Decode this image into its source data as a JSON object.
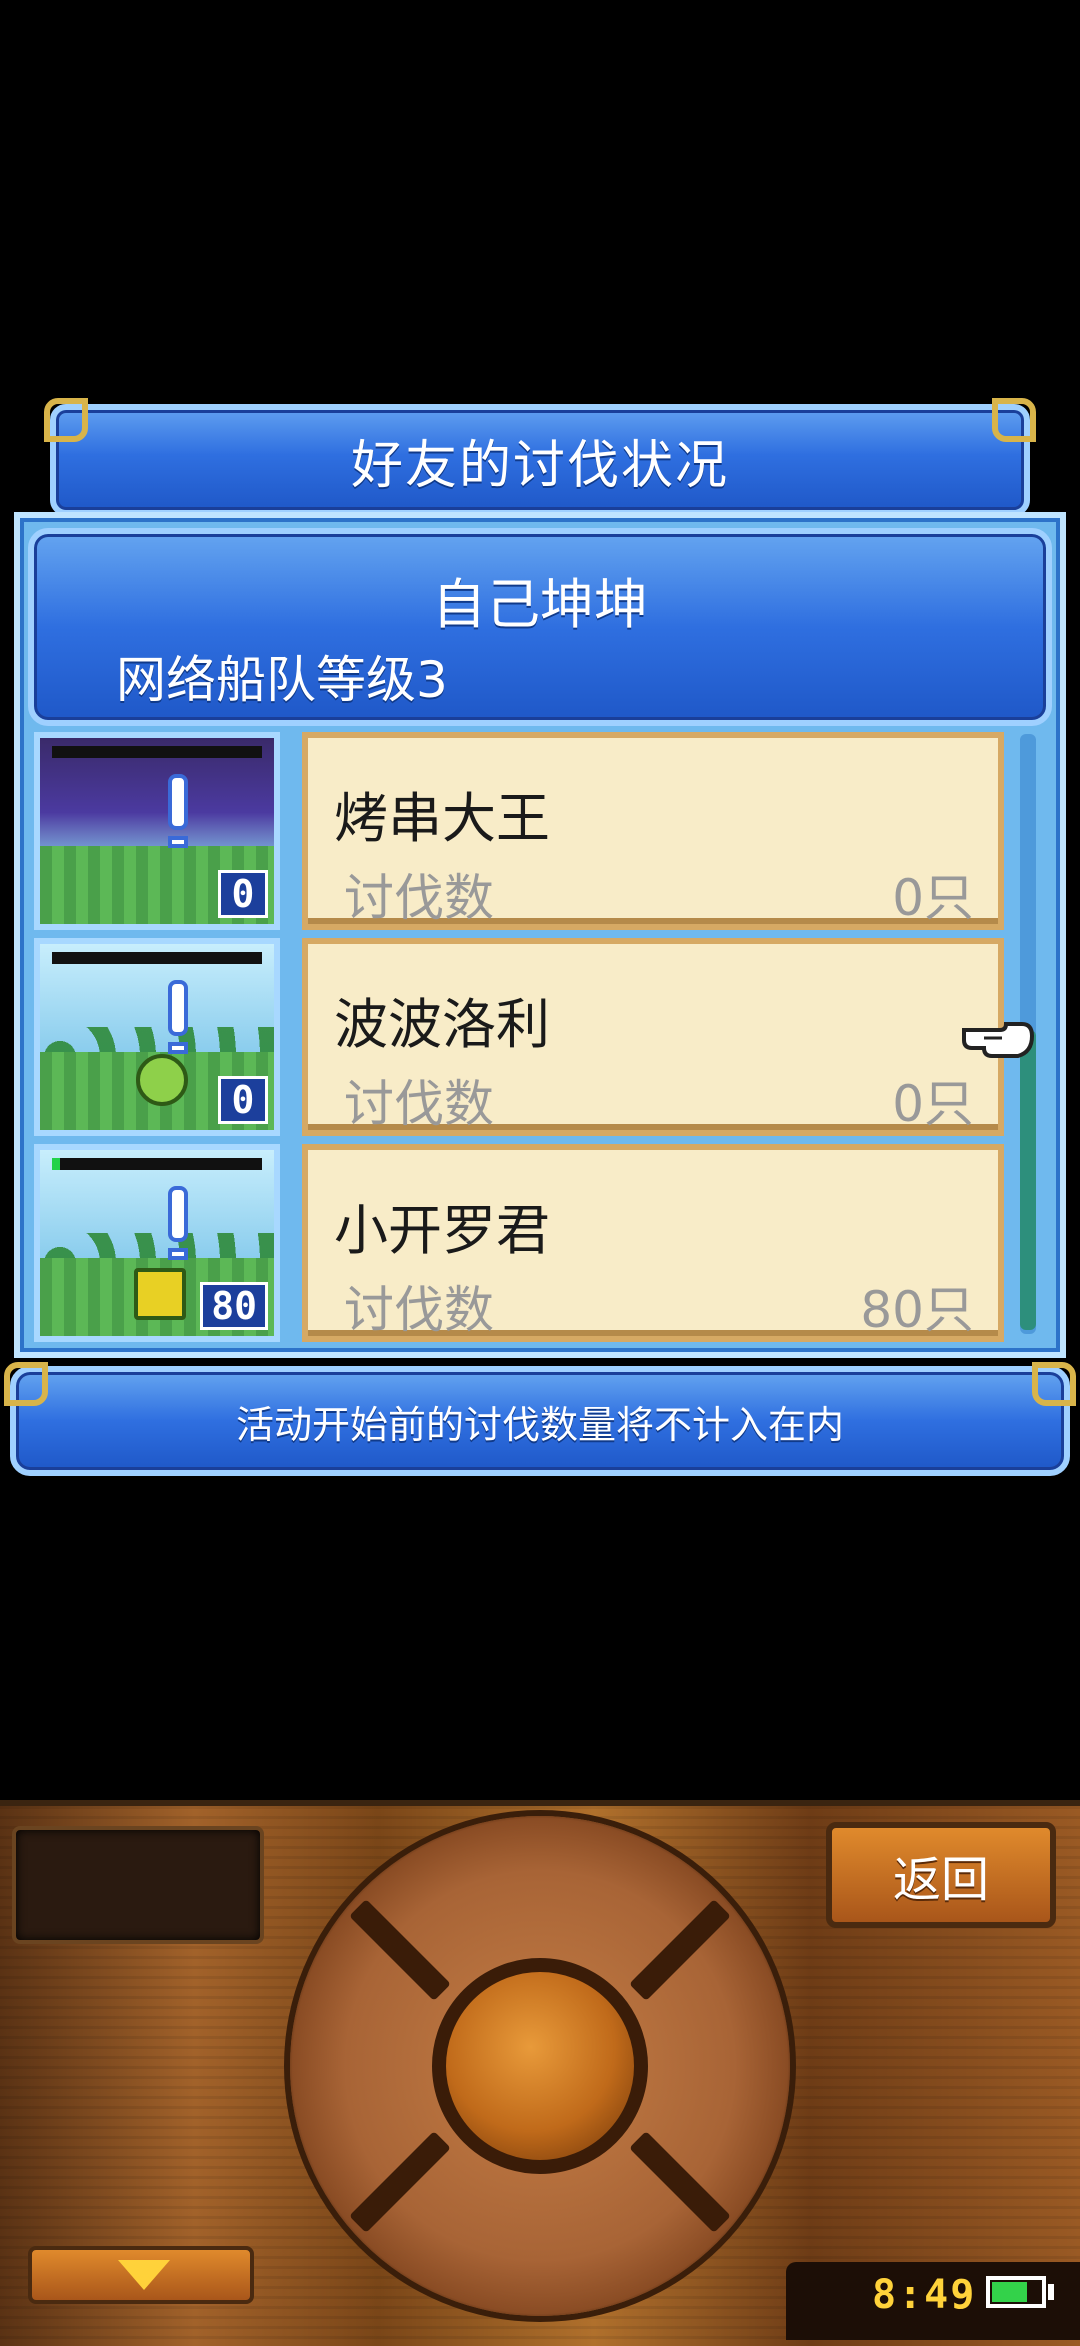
{
  "header": {
    "title": "好友的讨伐状况"
  },
  "profile": {
    "name": "自己坤坤",
    "level": "网络船队等级3"
  },
  "list": {
    "items": [
      {
        "name": "烤串大王",
        "label": "讨伐数",
        "value": "0只",
        "badge": "0",
        "hp_fraction": 0
      },
      {
        "name": "波波洛利",
        "label": "讨伐数",
        "value": "0只",
        "badge": "0",
        "hp_fraction": 0
      },
      {
        "name": "小开罗君",
        "label": "讨伐数",
        "value": "80只",
        "badge": "80",
        "hp_fraction": 0.04
      }
    ]
  },
  "notice": {
    "text": "活动开始前的讨伐数量将不计入在内"
  },
  "controls": {
    "back_label": "返回"
  },
  "status": {
    "time": "8:49",
    "battery_fraction": 0.75
  },
  "colors": {
    "panel_blue": "#2f6fe0",
    "card_cream": "#f8ecc8",
    "wood": "#a2622a",
    "clock_yellow": "#ffd23a"
  },
  "icons": {
    "pointer": "pointing-hand-icon",
    "down": "down-arrow-icon",
    "battery": "battery-icon"
  }
}
